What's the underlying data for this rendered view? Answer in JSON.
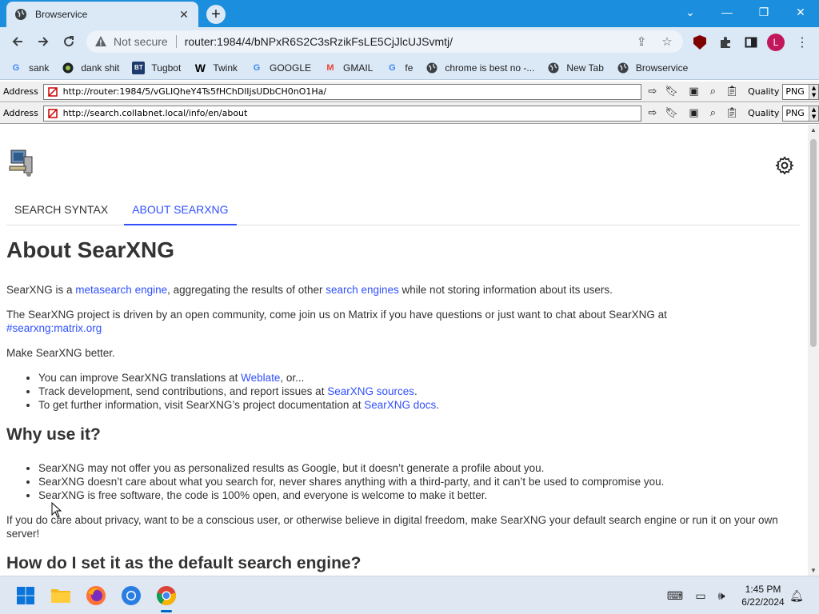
{
  "browser": {
    "tab_title": "Browservice",
    "tab_close": "✕",
    "new_tab": "+",
    "window_controls": {
      "dropdown": "⌄",
      "minimize": "—",
      "restore": "❐",
      "close": "✕"
    }
  },
  "omnibox": {
    "security_label": "Not secure",
    "url": "router:1984/4/bNPxR6S2C3sRzikFsLE5CjJlcUJSvmtj/"
  },
  "bookmarks": [
    {
      "label": "sank",
      "icon": "google-icon"
    },
    {
      "label": "dank shit",
      "icon": "app-icon"
    },
    {
      "label": "Tugbot",
      "icon": "bt-icon"
    },
    {
      "label": "Twink",
      "icon": "w-icon"
    },
    {
      "label": "GOOGLE",
      "icon": "google-icon"
    },
    {
      "label": "GMAIL",
      "icon": "gmail-icon"
    },
    {
      "label": "fe",
      "icon": "google-icon"
    },
    {
      "label": "chrome is best no -...",
      "icon": "globe-icon"
    },
    {
      "label": "New Tab",
      "icon": "globe-icon"
    },
    {
      "label": "Browservice",
      "icon": "globe-icon"
    }
  ],
  "address_bars": [
    {
      "label": "Address",
      "url": "http://router:1984/5/vGLIQheY4Ts5fHChDlIjsUDbCH0nO1Ha/",
      "quality_label": "Quality",
      "quality_value": "PNG"
    },
    {
      "label": "Address",
      "url": "http://search.collabnet.local/info/en/about",
      "quality_label": "Quality",
      "quality_value": "PNG"
    }
  ],
  "page": {
    "tabs": [
      {
        "label": "SEARCH SYNTAX",
        "active": false
      },
      {
        "label": "ABOUT SEARXNG",
        "active": true
      }
    ],
    "title": "About SearXNG",
    "intro": {
      "p1_a": "SearXNG is a ",
      "p1_link1": "metasearch engine",
      "p1_b": ", aggregating the results of other ",
      "p1_link2": "search engines",
      "p1_c": " while not storing information about its users.",
      "p2_a": "The SearXNG project is driven by an open community, come join us on Matrix if you have questions or just want to chat about SearXNG at ",
      "p2_link": "#searxng:matrix.org",
      "p3": "Make SearXNG better."
    },
    "better_list": [
      {
        "a": "You can improve SearXNG translations at ",
        "link": "Weblate",
        "b": ", or..."
      },
      {
        "a": "Track development, send contributions, and report issues at ",
        "link": "SearXNG sources",
        "b": "."
      },
      {
        "a": "To get further information, visit SearXNG’s project documentation at ",
        "link": "SearXNG docs",
        "b": "."
      }
    ],
    "why_heading": "Why use it?",
    "why_list": [
      "SearXNG may not offer you as personalized results as Google, but it doesn’t generate a profile about you.",
      "SearXNG doesn’t care about what you search for, never shares anything with a third-party, and it can’t be used to compromise you.",
      "SearXNG is free software, the code is 100% open, and everyone is welcome to make it better."
    ],
    "privacy_para": "If you do care about privacy, want to be a conscious user, or otherwise believe in digital freedom, make SearXNG your default search engine or run it on your own server!",
    "default_heading": "How do I set it as the default search engine?"
  },
  "taskbar": {
    "time": "1:45 PM",
    "date": "6/22/2024"
  }
}
